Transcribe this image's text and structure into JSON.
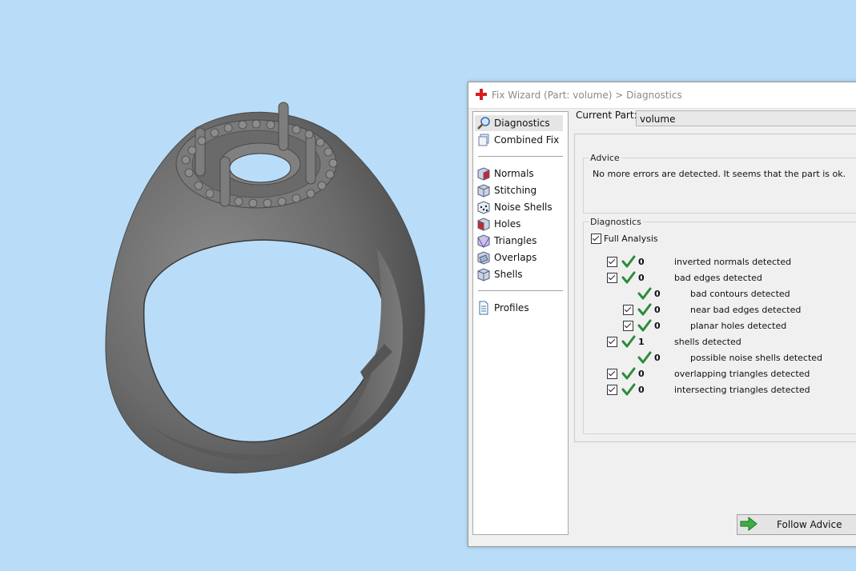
{
  "dialog": {
    "title": "Fix Wizard (Part: volume) > Diagnostics",
    "nav": {
      "group1": [
        {
          "label": "Diagnostics",
          "icon": "magnifier-icon",
          "selected": true
        },
        {
          "label": "Combined Fix",
          "icon": "pages-icon",
          "selected": false
        }
      ],
      "group2": [
        {
          "label": "Normals",
          "icon": "normals-cube-icon"
        },
        {
          "label": "Stitching",
          "icon": "stitching-cube-icon"
        },
        {
          "label": "Noise Shells",
          "icon": "noise-shells-dice-icon"
        },
        {
          "label": "Holes",
          "icon": "holes-cube-icon"
        },
        {
          "label": "Triangles",
          "icon": "triangles-cube-icon"
        },
        {
          "label": "Overlaps",
          "icon": "overlaps-cube-icon"
        },
        {
          "label": "Shells",
          "icon": "shells-cube-icon"
        }
      ],
      "group3": [
        {
          "label": "Profiles",
          "icon": "document-icon"
        }
      ]
    },
    "current_part": {
      "label": "Current Part:",
      "value": "volume"
    },
    "advice": {
      "title": "Advice",
      "text": "No more errors are detected. It seems that the part is ok."
    },
    "diagnostics": {
      "title": "Diagnostics",
      "full_analysis": {
        "label": "Full Analysis",
        "checked": true
      },
      "rows": [
        {
          "count": "0",
          "label": "inverted normals detected",
          "checkbox": true,
          "indent": false
        },
        {
          "count": "0",
          "label": "bad edges detected",
          "checkbox": true,
          "indent": false
        },
        {
          "count": "0",
          "label": "bad contours detected",
          "checkbox": false,
          "indent": true
        },
        {
          "count": "0",
          "label": "near bad edges detected",
          "checkbox": true,
          "indent": true
        },
        {
          "count": "0",
          "label": "planar holes detected",
          "checkbox": true,
          "indent": true
        },
        {
          "count": "1",
          "label": "shells detected",
          "checkbox": true,
          "indent": false
        },
        {
          "count": "0",
          "label": "possible noise shells detected",
          "checkbox": false,
          "indent": true
        },
        {
          "count": "0",
          "label": "overlapping triangles detected",
          "checkbox": true,
          "indent": false
        },
        {
          "count": "0",
          "label": "intersecting triangles detected",
          "checkbox": true,
          "indent": false
        }
      ]
    },
    "follow_advice": "Follow Advice"
  },
  "colors": {
    "viewport_bg": "#b9ddf8",
    "ring": "#6b6b6b",
    "ok_check": "#2e8b3c",
    "title_icon": "#d42020"
  }
}
